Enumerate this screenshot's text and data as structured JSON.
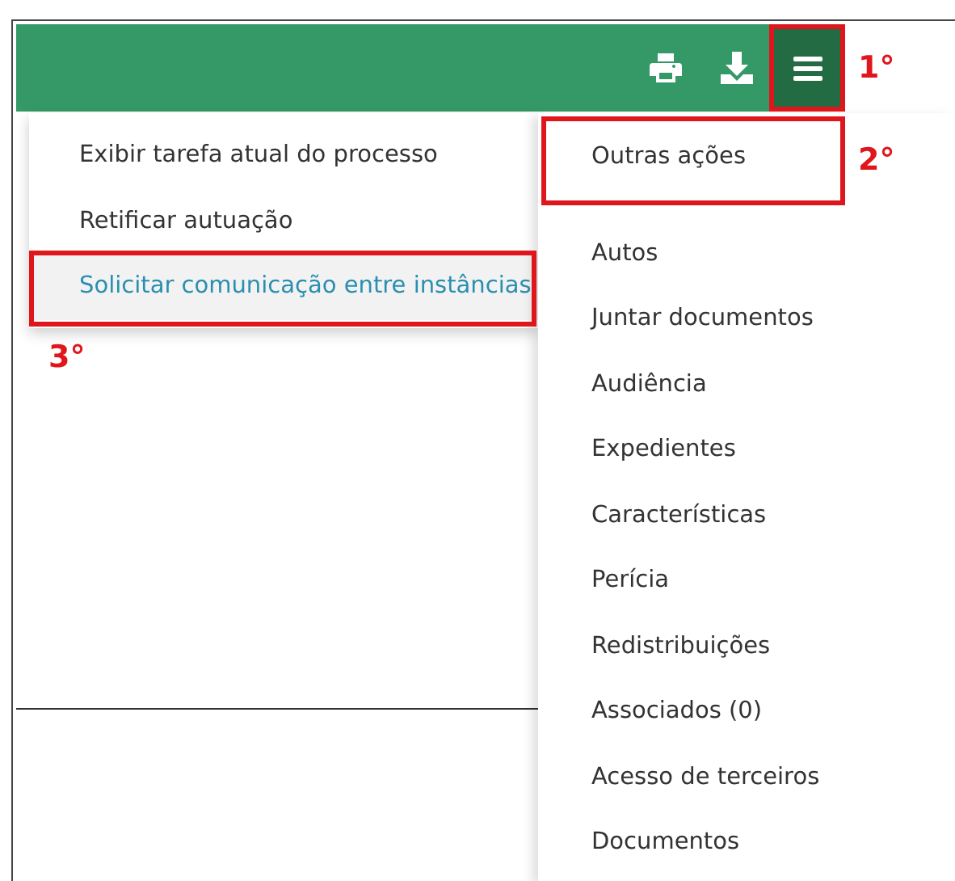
{
  "toolbar": {
    "buttons": [
      {
        "kind": "print",
        "selected": false
      },
      {
        "kind": "download",
        "selected": false
      },
      {
        "kind": "menu",
        "selected": true,
        "step": "1°"
      }
    ]
  },
  "submenu": {
    "items": [
      {
        "label": "Exibir tarefa atual do processo",
        "selected": false
      },
      {
        "label": "Retificar autuação",
        "selected": false
      },
      {
        "label": "Solicitar comunicação entre instâncias",
        "selected": true,
        "step": "3°"
      }
    ]
  },
  "menu": {
    "items": [
      {
        "label": "Outras ações",
        "step": "2°"
      },
      {
        "label": "Autos"
      },
      {
        "label": "Juntar documentos"
      },
      {
        "label": "Audiência"
      },
      {
        "label": "Expedientes"
      },
      {
        "label": "Características"
      },
      {
        "label": "Perícia"
      },
      {
        "label": "Redistribuições"
      },
      {
        "label": "Associados (0)"
      },
      {
        "label": "Acesso de terceiros"
      },
      {
        "label": "Documentos"
      }
    ]
  }
}
